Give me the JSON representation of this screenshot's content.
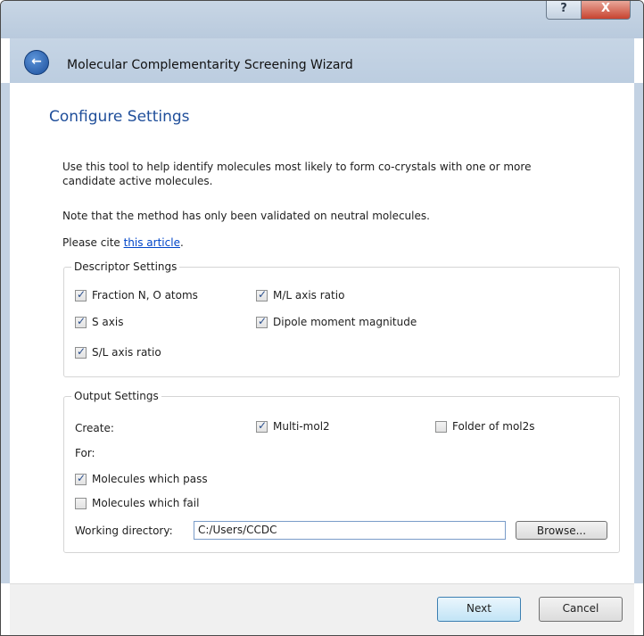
{
  "window": {
    "help_glyph": "?",
    "close_glyph": "X",
    "back_glyph": "←",
    "title": "Molecular Complementarity Screening Wizard"
  },
  "page": {
    "title": "Configure Settings",
    "intro_line1": "Use this tool to help identify molecules most likely to form co-crystals with one or more",
    "intro_line2": "candidate active molecules.",
    "note": "Note that the method has only been validated on neutral molecules.",
    "cite_prefix": "Please cite ",
    "cite_link": "this article",
    "cite_suffix": "."
  },
  "descriptor_settings": {
    "label": "Descriptor Settings",
    "items": [
      {
        "label": "Fraction N, O atoms",
        "checked": true
      },
      {
        "label": "M/L axis ratio",
        "checked": true
      },
      {
        "label": "S axis",
        "checked": true
      },
      {
        "label": "Dipole moment magnitude",
        "checked": true
      },
      {
        "label": "S/L axis ratio",
        "checked": true
      }
    ]
  },
  "output_settings": {
    "label": "Output Settings",
    "create_label": "Create:",
    "multi_mol2": {
      "label": "Multi-mol2",
      "checked": true
    },
    "folder_mol2s": {
      "label": "Folder of mol2s",
      "checked": false
    },
    "for_label": "For:",
    "pass": {
      "label": "Molecules which pass",
      "checked": true
    },
    "fail": {
      "label": "Molecules which fail",
      "checked": false
    },
    "working_dir_label": "Working directory:",
    "working_dir_value": "C:/Users/CCDC",
    "browse_label": "Browse..."
  },
  "footer": {
    "next_label": "Next",
    "cancel_label": "Cancel"
  },
  "check_glyph": "✓"
}
